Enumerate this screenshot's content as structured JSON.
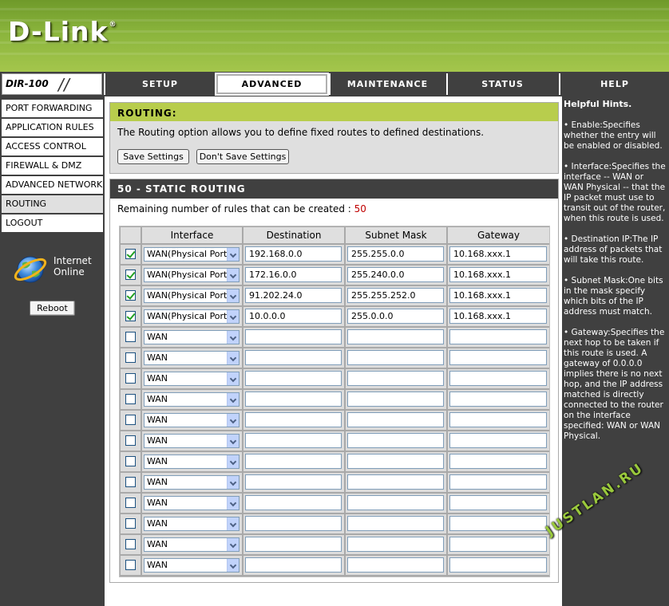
{
  "brand": {
    "logo": "D-Link",
    "registered": "®",
    "model": "DIR-100"
  },
  "nav": {
    "tabs": [
      {
        "label": "SETUP"
      },
      {
        "label": "ADVANCED"
      },
      {
        "label": "MAINTENANCE"
      },
      {
        "label": "STATUS"
      },
      {
        "label": "HELP"
      }
    ],
    "active_tab": "ADVANCED"
  },
  "sidebar": {
    "items": [
      {
        "label": "PORT FORWARDING"
      },
      {
        "label": "APPLICATION RULES"
      },
      {
        "label": "ACCESS CONTROL"
      },
      {
        "label": "FIREWALL & DMZ"
      },
      {
        "label": "ADVANCED NETWORK"
      },
      {
        "label": "ROUTING"
      },
      {
        "label": "LOGOUT"
      }
    ],
    "active_item": "ROUTING",
    "status_line1": "Internet",
    "status_line2": "Online",
    "status_icon": "globe-icon",
    "reboot_label": "Reboot"
  },
  "routing": {
    "title": "ROUTING:",
    "description": "The Routing option allows you to define fixed routes to defined destinations.",
    "save_label": "Save Settings",
    "dont_save_label": "Don't Save Settings"
  },
  "static_routing": {
    "title": "50 - STATIC ROUTING",
    "remaining_text": "Remaining number of rules that can be created :",
    "remaining_count": "50",
    "columns": [
      "Interface",
      "Destination",
      "Subnet Mask",
      "Gateway"
    ],
    "rows": [
      {
        "enabled": true,
        "interface": "WAN(Physical Port)",
        "destination": "192.168.0.0",
        "mask": "255.255.0.0",
        "gateway": "10.168.xxx.1"
      },
      {
        "enabled": true,
        "interface": "WAN(Physical Port)",
        "destination": "172.16.0.0",
        "mask": "255.240.0.0",
        "gateway": "10.168.xxx.1"
      },
      {
        "enabled": true,
        "interface": "WAN(Physical Port)",
        "destination": "91.202.24.0",
        "mask": "255.255.252.0",
        "gateway": " 10.168.xxx.1"
      },
      {
        "enabled": true,
        "interface": "WAN(Physical Port)",
        "destination": "10.0.0.0",
        "mask": "255.0.0.0",
        "gateway": "10.168.xxx.1"
      },
      {
        "enabled": false,
        "interface": "WAN",
        "destination": "",
        "mask": "",
        "gateway": ""
      },
      {
        "enabled": false,
        "interface": "WAN",
        "destination": "",
        "mask": "",
        "gateway": ""
      },
      {
        "enabled": false,
        "interface": "WAN",
        "destination": "",
        "mask": "",
        "gateway": ""
      },
      {
        "enabled": false,
        "interface": "WAN",
        "destination": "",
        "mask": "",
        "gateway": ""
      },
      {
        "enabled": false,
        "interface": "WAN",
        "destination": "",
        "mask": "",
        "gateway": ""
      },
      {
        "enabled": false,
        "interface": "WAN",
        "destination": "",
        "mask": "",
        "gateway": ""
      },
      {
        "enabled": false,
        "interface": "WAN",
        "destination": "",
        "mask": "",
        "gateway": ""
      },
      {
        "enabled": false,
        "interface": "WAN",
        "destination": "",
        "mask": "",
        "gateway": ""
      },
      {
        "enabled": false,
        "interface": "WAN",
        "destination": "",
        "mask": "",
        "gateway": ""
      },
      {
        "enabled": false,
        "interface": "WAN",
        "destination": "",
        "mask": "",
        "gateway": ""
      },
      {
        "enabled": false,
        "interface": "WAN",
        "destination": "",
        "mask": "",
        "gateway": ""
      },
      {
        "enabled": false,
        "interface": "WAN",
        "destination": "",
        "mask": "",
        "gateway": ""
      }
    ]
  },
  "hints": {
    "title": "Helpful Hints.",
    "items": [
      "• Enable:Specifies whether the entry will be enabled or disabled.",
      "• Interface:Specifies the interface -- WAN or WAN Physical -- that the IP packet must use to transit out of the router, when this route is used.",
      "• Destination IP:The IP address of packets that will take this route.",
      "• Subnet Mask:One bits in the mask specify which bits of the IP address must match.",
      "• Gateway:Specifies the next hop to be taken if this route is used. A gateway of 0.0.0.0 implies there is no next hop, and the IP address matched is directly connected to the router on the interface specified: WAN or WAN Physical."
    ]
  },
  "watermark": "JUSTLAN.RU"
}
